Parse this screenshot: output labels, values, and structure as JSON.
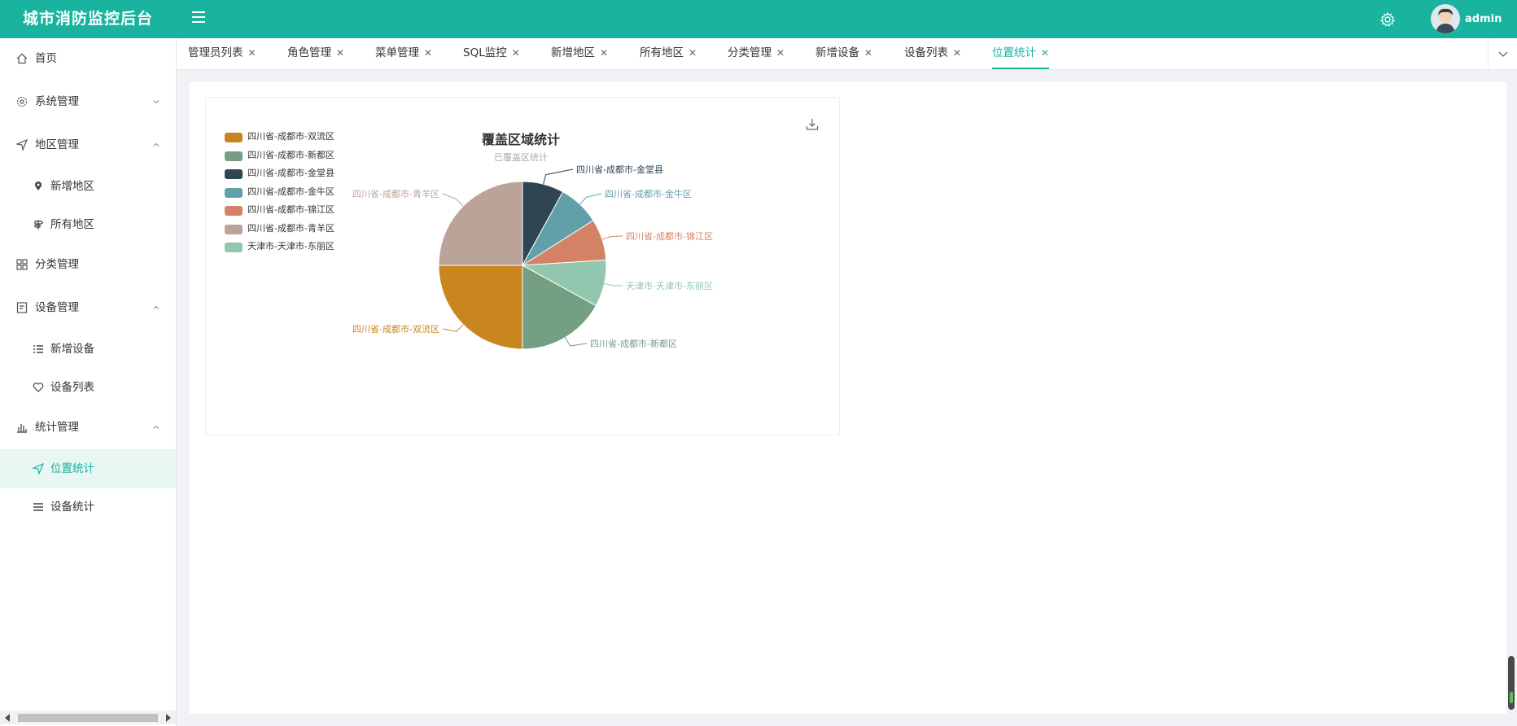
{
  "app": {
    "title": "城市消防监控后台",
    "username": "admin"
  },
  "sidebar": {
    "items": [
      {
        "label": "首页"
      },
      {
        "label": "系统管理"
      },
      {
        "label": "地区管理"
      },
      {
        "label": "新增地区"
      },
      {
        "label": "所有地区"
      },
      {
        "label": "分类管理"
      },
      {
        "label": "设备管理"
      },
      {
        "label": "新增设备"
      },
      {
        "label": "设备列表"
      },
      {
        "label": "统计管理"
      },
      {
        "label": "位置统计"
      },
      {
        "label": "设备统计"
      }
    ]
  },
  "tabs": [
    {
      "label": "管理员列表"
    },
    {
      "label": "角色管理"
    },
    {
      "label": "菜单管理"
    },
    {
      "label": "SQL监控"
    },
    {
      "label": "新增地区"
    },
    {
      "label": "所有地区"
    },
    {
      "label": "分类管理"
    },
    {
      "label": "新增设备"
    },
    {
      "label": "设备列表"
    },
    {
      "label": "位置统计"
    }
  ],
  "chart_data": {
    "type": "pie",
    "title": "覆盖区域统计",
    "subtitle": "已覆盖区统计",
    "legend_position": "top-left",
    "slices": [
      {
        "name": "四川省-成都市-双流区",
        "value": 25,
        "color": "#c9861f"
      },
      {
        "name": "四川省-成都市-新都区",
        "value": 17,
        "color": "#749f83"
      },
      {
        "name": "四川省-成都市-金堂县",
        "value": 8,
        "color": "#2f4554"
      },
      {
        "name": "四川省-成都市-金牛区",
        "value": 8,
        "color": "#61a0a8"
      },
      {
        "name": "四川省-成都市-锦江区",
        "value": 8,
        "color": "#d48265"
      },
      {
        "name": "四川省-成都市-青羊区",
        "value": 25,
        "color": "#bca39a"
      },
      {
        "name": "天津市-天津市-东丽区",
        "value": 9,
        "color": "#91c7ae"
      }
    ]
  }
}
